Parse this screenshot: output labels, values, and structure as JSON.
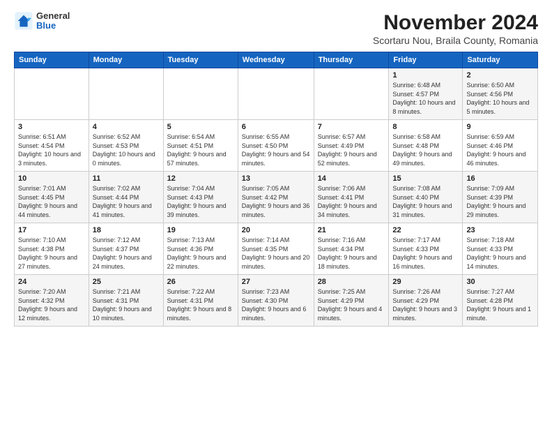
{
  "logo": {
    "general": "General",
    "blue": "Blue"
  },
  "title": "November 2024",
  "subtitle": "Scortaru Nou, Braila County, Romania",
  "days_of_week": [
    "Sunday",
    "Monday",
    "Tuesday",
    "Wednesday",
    "Thursday",
    "Friday",
    "Saturday"
  ],
  "weeks": [
    [
      {
        "day": "",
        "info": ""
      },
      {
        "day": "",
        "info": ""
      },
      {
        "day": "",
        "info": ""
      },
      {
        "day": "",
        "info": ""
      },
      {
        "day": "",
        "info": ""
      },
      {
        "day": "1",
        "info": "Sunrise: 6:48 AM\nSunset: 4:57 PM\nDaylight: 10 hours and 8 minutes."
      },
      {
        "day": "2",
        "info": "Sunrise: 6:50 AM\nSunset: 4:56 PM\nDaylight: 10 hours and 5 minutes."
      }
    ],
    [
      {
        "day": "3",
        "info": "Sunrise: 6:51 AM\nSunset: 4:54 PM\nDaylight: 10 hours and 3 minutes."
      },
      {
        "day": "4",
        "info": "Sunrise: 6:52 AM\nSunset: 4:53 PM\nDaylight: 10 hours and 0 minutes."
      },
      {
        "day": "5",
        "info": "Sunrise: 6:54 AM\nSunset: 4:51 PM\nDaylight: 9 hours and 57 minutes."
      },
      {
        "day": "6",
        "info": "Sunrise: 6:55 AM\nSunset: 4:50 PM\nDaylight: 9 hours and 54 minutes."
      },
      {
        "day": "7",
        "info": "Sunrise: 6:57 AM\nSunset: 4:49 PM\nDaylight: 9 hours and 52 minutes."
      },
      {
        "day": "8",
        "info": "Sunrise: 6:58 AM\nSunset: 4:48 PM\nDaylight: 9 hours and 49 minutes."
      },
      {
        "day": "9",
        "info": "Sunrise: 6:59 AM\nSunset: 4:46 PM\nDaylight: 9 hours and 46 minutes."
      }
    ],
    [
      {
        "day": "10",
        "info": "Sunrise: 7:01 AM\nSunset: 4:45 PM\nDaylight: 9 hours and 44 minutes."
      },
      {
        "day": "11",
        "info": "Sunrise: 7:02 AM\nSunset: 4:44 PM\nDaylight: 9 hours and 41 minutes."
      },
      {
        "day": "12",
        "info": "Sunrise: 7:04 AM\nSunset: 4:43 PM\nDaylight: 9 hours and 39 minutes."
      },
      {
        "day": "13",
        "info": "Sunrise: 7:05 AM\nSunset: 4:42 PM\nDaylight: 9 hours and 36 minutes."
      },
      {
        "day": "14",
        "info": "Sunrise: 7:06 AM\nSunset: 4:41 PM\nDaylight: 9 hours and 34 minutes."
      },
      {
        "day": "15",
        "info": "Sunrise: 7:08 AM\nSunset: 4:40 PM\nDaylight: 9 hours and 31 minutes."
      },
      {
        "day": "16",
        "info": "Sunrise: 7:09 AM\nSunset: 4:39 PM\nDaylight: 9 hours and 29 minutes."
      }
    ],
    [
      {
        "day": "17",
        "info": "Sunrise: 7:10 AM\nSunset: 4:38 PM\nDaylight: 9 hours and 27 minutes."
      },
      {
        "day": "18",
        "info": "Sunrise: 7:12 AM\nSunset: 4:37 PM\nDaylight: 9 hours and 24 minutes."
      },
      {
        "day": "19",
        "info": "Sunrise: 7:13 AM\nSunset: 4:36 PM\nDaylight: 9 hours and 22 minutes."
      },
      {
        "day": "20",
        "info": "Sunrise: 7:14 AM\nSunset: 4:35 PM\nDaylight: 9 hours and 20 minutes."
      },
      {
        "day": "21",
        "info": "Sunrise: 7:16 AM\nSunset: 4:34 PM\nDaylight: 9 hours and 18 minutes."
      },
      {
        "day": "22",
        "info": "Sunrise: 7:17 AM\nSunset: 4:33 PM\nDaylight: 9 hours and 16 minutes."
      },
      {
        "day": "23",
        "info": "Sunrise: 7:18 AM\nSunset: 4:33 PM\nDaylight: 9 hours and 14 minutes."
      }
    ],
    [
      {
        "day": "24",
        "info": "Sunrise: 7:20 AM\nSunset: 4:32 PM\nDaylight: 9 hours and 12 minutes."
      },
      {
        "day": "25",
        "info": "Sunrise: 7:21 AM\nSunset: 4:31 PM\nDaylight: 9 hours and 10 minutes."
      },
      {
        "day": "26",
        "info": "Sunrise: 7:22 AM\nSunset: 4:31 PM\nDaylight: 9 hours and 8 minutes."
      },
      {
        "day": "27",
        "info": "Sunrise: 7:23 AM\nSunset: 4:30 PM\nDaylight: 9 hours and 6 minutes."
      },
      {
        "day": "28",
        "info": "Sunrise: 7:25 AM\nSunset: 4:29 PM\nDaylight: 9 hours and 4 minutes."
      },
      {
        "day": "29",
        "info": "Sunrise: 7:26 AM\nSunset: 4:29 PM\nDaylight: 9 hours and 3 minutes."
      },
      {
        "day": "30",
        "info": "Sunrise: 7:27 AM\nSunset: 4:28 PM\nDaylight: 9 hours and 1 minute."
      }
    ]
  ]
}
